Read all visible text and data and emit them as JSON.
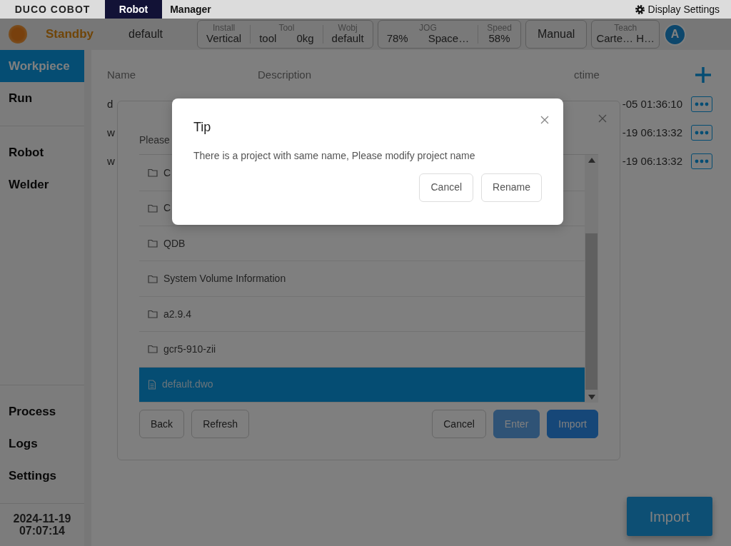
{
  "top_bar": {
    "logo": "DUCO COBOT",
    "tabs": [
      {
        "label": "Robot",
        "selected": true
      },
      {
        "label": "Manager",
        "selected": false
      }
    ],
    "display_settings": "Display Settings"
  },
  "status_bar": {
    "state": "Standby",
    "program": "default",
    "groups": [
      {
        "fields": [
          {
            "label": "Install",
            "values": [
              "Vertical"
            ]
          },
          {
            "label": "Tool",
            "values": [
              "tool",
              "0kg"
            ]
          },
          {
            "label": "Wobj",
            "values": [
              "default"
            ]
          }
        ]
      },
      {
        "fields": [
          {
            "label": "JOG",
            "values": [
              "78%",
              "Space…"
            ]
          },
          {
            "label": "Speed",
            "values": [
              "58%"
            ]
          }
        ]
      }
    ],
    "mode_button": "Manual",
    "teach": {
      "label": "Teach",
      "value": "Carte… H…"
    },
    "avatar": "A"
  },
  "sidebar": {
    "groups": [
      {
        "items": [
          {
            "label": "Workpiece",
            "selected": true
          },
          {
            "label": "Run",
            "selected": false
          }
        ]
      },
      {
        "items": [
          {
            "label": "Robot",
            "selected": false
          },
          {
            "label": "Welder",
            "selected": false
          }
        ]
      },
      {
        "items": [
          {
            "label": "Process",
            "selected": false
          },
          {
            "label": "Logs",
            "selected": false
          },
          {
            "label": "Settings",
            "selected": false
          }
        ]
      }
    ],
    "date": "2024-11-19",
    "time": "07:07:14"
  },
  "table": {
    "columns": [
      "Name",
      "Description",
      "ctime"
    ],
    "rows": [
      {
        "name": "d",
        "ctime": "-05 01:36:10"
      },
      {
        "name": "w",
        "ctime": "-19 06:13:32"
      },
      {
        "name": "w",
        "ctime": "-19 06:13:32"
      }
    ]
  },
  "import_button": "Import",
  "file_dialog": {
    "path_label": "Please",
    "files": [
      {
        "name": "C",
        "kind": "folder",
        "selected": false
      },
      {
        "name": "C",
        "kind": "folder",
        "selected": false
      },
      {
        "name": "QDB",
        "kind": "folder",
        "selected": false
      },
      {
        "name": "System Volume Information",
        "kind": "folder",
        "selected": false
      },
      {
        "name": "a2.9.4",
        "kind": "folder",
        "selected": false
      },
      {
        "name": "gcr5-910-zii",
        "kind": "folder",
        "selected": false
      },
      {
        "name": "default.dwo",
        "kind": "file",
        "selected": true
      }
    ],
    "left_buttons": [
      {
        "label": "Back",
        "disabled": false
      },
      {
        "label": "Refresh",
        "disabled": false
      }
    ],
    "right_buttons": [
      {
        "label": "Cancel",
        "kind": "plain",
        "disabled": false
      },
      {
        "label": "Enter",
        "kind": "primary",
        "disabled": true
      },
      {
        "label": "Import",
        "kind": "primary",
        "disabled": false
      }
    ]
  },
  "tip_dialog": {
    "title": "Tip",
    "message": "There is a project with same name, Please modify project name",
    "buttons": [
      "Cancel",
      "Rename"
    ]
  }
}
